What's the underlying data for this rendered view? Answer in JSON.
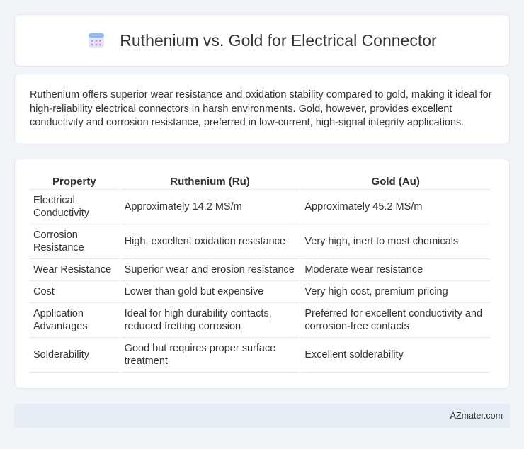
{
  "header": {
    "title": "Ruthenium vs. Gold for Electrical Connector",
    "icon": "calendar-icon"
  },
  "summary": {
    "text": "Ruthenium offers superior wear resistance and oxidation stability compared to gold, making it ideal for high-reliability electrical connectors in harsh environments. Gold, however, provides excellent conductivity and corrosion resistance, preferred in low-current, high-signal integrity applications."
  },
  "table": {
    "headers": [
      "Property",
      "Ruthenium (Ru)",
      "Gold (Au)"
    ],
    "rows": [
      [
        "Electrical Conductivity",
        "Approximately 14.2 MS/m",
        "Approximately 45.2 MS/m"
      ],
      [
        "Corrosion Resistance",
        "High, excellent oxidation resistance",
        "Very high, inert to most chemicals"
      ],
      [
        "Wear Resistance",
        "Superior wear and erosion resistance",
        "Moderate wear resistance"
      ],
      [
        "Cost",
        "Lower than gold but expensive",
        "Very high cost, premium pricing"
      ],
      [
        "Application Advantages",
        "Ideal for high durability contacts, reduced fretting corrosion",
        "Preferred for excellent conductivity and corrosion-free contacts"
      ],
      [
        "Solderability",
        "Good but requires proper surface treatment",
        "Excellent solderability"
      ]
    ]
  },
  "footer": {
    "text": "AZmater.com"
  }
}
